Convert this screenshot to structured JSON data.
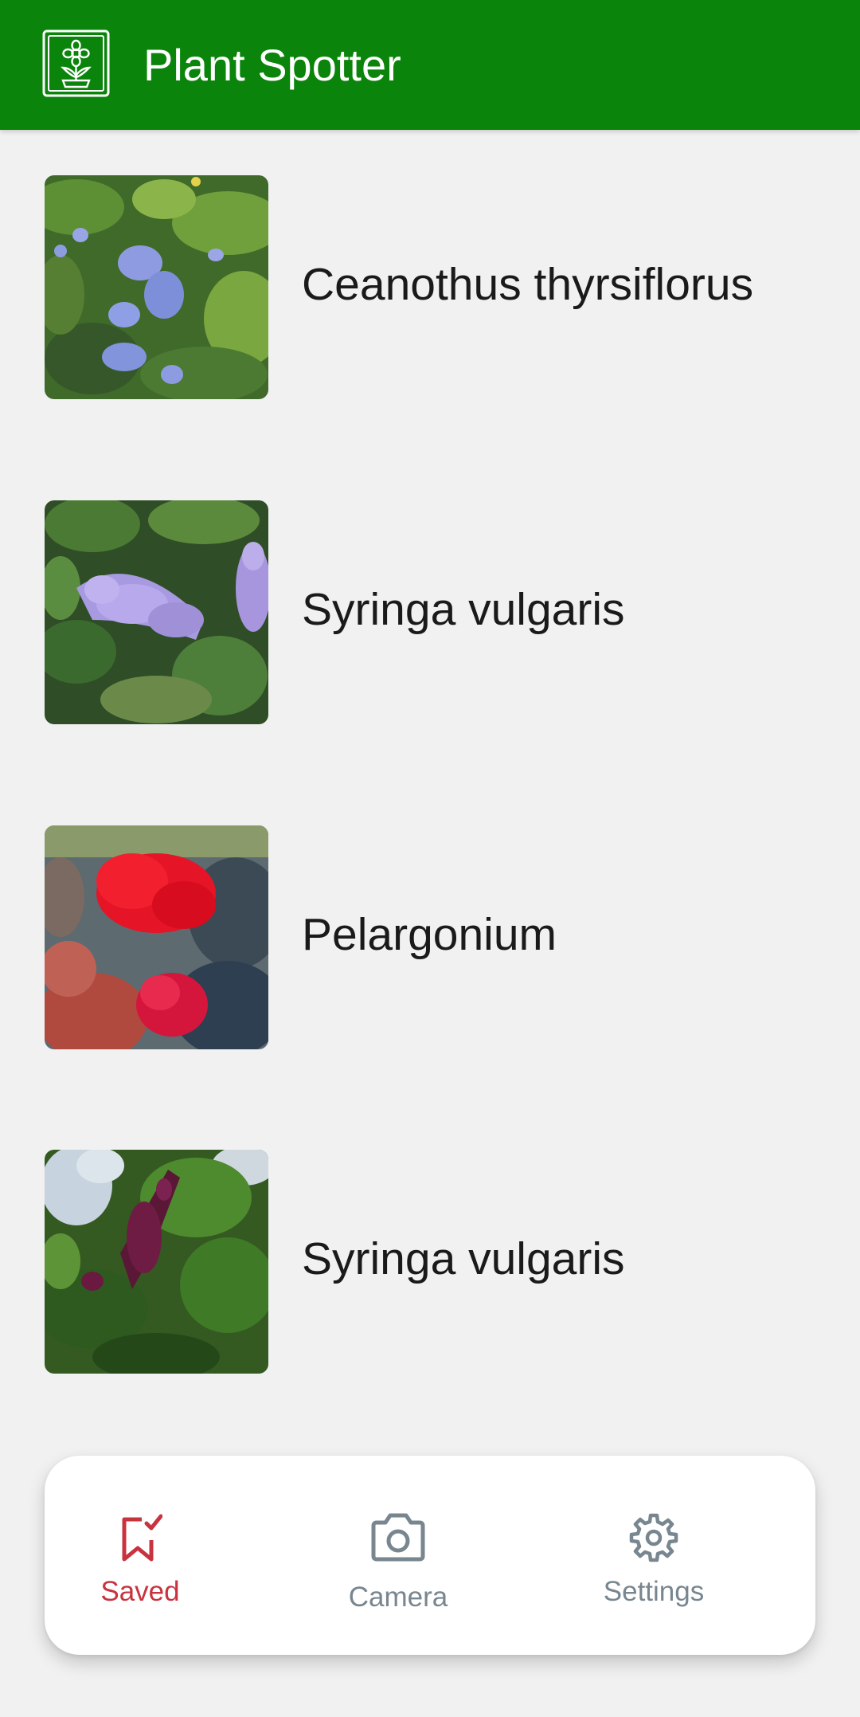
{
  "app": {
    "title": "Plant Spotter",
    "logo_icon": "flower-pot-icon",
    "accent_color": "#0b840b"
  },
  "plants": [
    {
      "name": "Ceanothus thyrsiflorus",
      "photo": "blue-flower-cluster-photo"
    },
    {
      "name": "Syringa vulgaris",
      "photo": "lilac-flower-photo"
    },
    {
      "name": "Pelargonium",
      "photo": "red-geranium-photo"
    },
    {
      "name": "Syringa vulgaris",
      "photo": "purple-lilac-tree-photo"
    }
  ],
  "nav": {
    "active": "saved",
    "active_color": "#c8333f",
    "inactive_color": "#78868f",
    "items": [
      {
        "id": "saved",
        "label": "Saved",
        "icon": "bookmark-check-icon"
      },
      {
        "id": "camera",
        "label": "Camera",
        "icon": "camera-icon"
      },
      {
        "id": "settings",
        "label": "Settings",
        "icon": "gear-icon"
      }
    ]
  }
}
